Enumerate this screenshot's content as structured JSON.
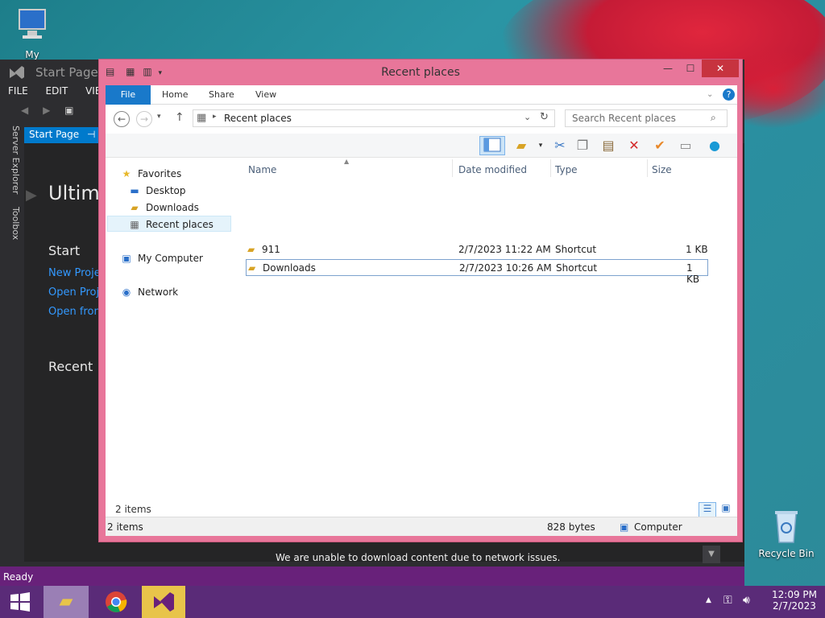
{
  "desktop": {
    "my_computer_label": "My Computer",
    "recycle_bin_label": "Recycle Bin"
  },
  "vs": {
    "title": "Start Page -",
    "menu": [
      "FILE",
      "EDIT",
      "VIEW"
    ],
    "side_tabs": [
      "Server Explorer",
      "Toolbox"
    ],
    "tab_label": "Start Page",
    "heading": "Ultima",
    "start_heading": "Start",
    "links": [
      "New Proje",
      "Open Proj",
      "Open from"
    ],
    "recent_heading": "Recent",
    "message": "We are unable to download content due to network issues.",
    "status": "Ready"
  },
  "explorer": {
    "title": "Recent places",
    "ribbon_tabs": [
      "File",
      "Home",
      "Share",
      "View"
    ],
    "address": "Recent places",
    "search_placeholder": "Search Recent places",
    "nav": {
      "favorites": "Favorites",
      "desktop": "Desktop",
      "downloads": "Downloads",
      "recent": "Recent places",
      "computer": "My Computer",
      "network": "Network"
    },
    "columns": [
      "Name",
      "Date modified",
      "Type",
      "Size"
    ],
    "rows": [
      {
        "name": "911",
        "date": "2/7/2023 11:22 AM",
        "type": "Shortcut",
        "size": "1 KB"
      },
      {
        "name": "Downloads",
        "date": "2/7/2023 10:26 AM",
        "type": "Shortcut",
        "size": "1 KB"
      }
    ],
    "items_count": "2 items",
    "status": {
      "items": "2 items",
      "size": "828 bytes",
      "location": "Computer"
    }
  },
  "taskbar": {
    "time": "12:09 PM",
    "date": "2/7/2023"
  }
}
